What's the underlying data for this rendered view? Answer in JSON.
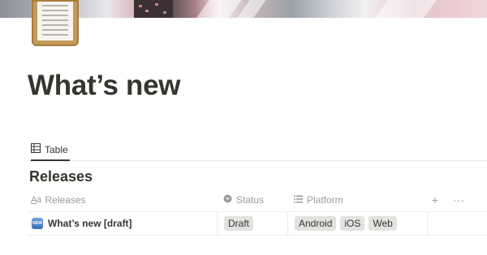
{
  "page": {
    "title": "What’s new"
  },
  "views": {
    "tabs": [
      {
        "label": "Table",
        "icon": "table-icon"
      }
    ]
  },
  "database": {
    "title": "Releases",
    "columns": [
      {
        "label": "Releases",
        "icon": "text-property-icon"
      },
      {
        "label": "Status",
        "icon": "status-property-icon"
      },
      {
        "label": "Platform",
        "icon": "list-property-icon"
      }
    ],
    "header_actions": {
      "add": "+",
      "more": "···"
    },
    "rows": [
      {
        "icon": "new-badge-icon",
        "icon_text": "NEW",
        "name": "What’s new [draft]",
        "status": "Draft",
        "platforms": [
          "Android",
          "iOS",
          "Web"
        ]
      }
    ]
  },
  "colors": {
    "text": "#37352f",
    "muted": "#9b9a97",
    "pill": "#e3e2e0",
    "icon_gold": "#c29a5a"
  }
}
